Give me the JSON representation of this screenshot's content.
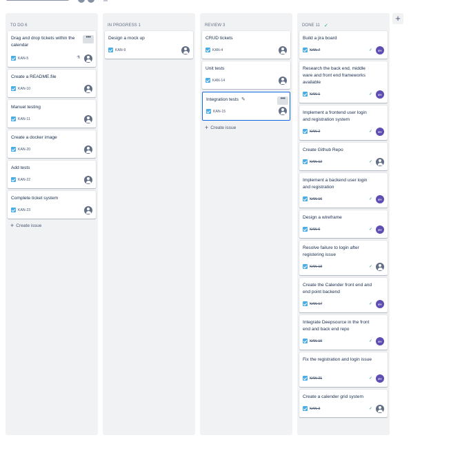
{
  "columns": [
    {
      "title": "TO DO 6",
      "create_label": "Create issue",
      "cards": [
        {
          "title": "Drag and drop tickets within the calendar",
          "key": "KAN-5"
        },
        {
          "title": "Create a README.file",
          "key": "KAN-10"
        },
        {
          "title": "Manuel testing",
          "key": "KAN-11"
        },
        {
          "title": "Create a docker image",
          "key": "KAN-20"
        },
        {
          "title": "Add tests",
          "key": "KAN-22"
        },
        {
          "title": "Complete ticket system",
          "key": "KAN-23"
        }
      ]
    },
    {
      "title": "IN PROGRESS 1",
      "cards": [
        {
          "title": "Design a mock up",
          "key": "KAN-9"
        }
      ]
    },
    {
      "title": "REVIEW 3",
      "create_label": "Create issue",
      "cards": [
        {
          "title": "CRUD tickets",
          "key": "KAN-4"
        },
        {
          "title": "Unit tests",
          "key": "KAN-14"
        },
        {
          "title": "Integration tests",
          "key": "KAN-15"
        }
      ]
    },
    {
      "title": "DONE 11",
      "cards": [
        {
          "title": "Build a jira board",
          "key": "KAN-7",
          "initials": "EY"
        },
        {
          "title": "Research the back end, middle ware and front end frameworks available",
          "key": "KAN-1",
          "initials": "EY"
        },
        {
          "title": "Implement a frontend user login and registration system",
          "key": "KAN-2",
          "initials": "EY"
        },
        {
          "title": "Create Github Repo",
          "key": "KAN-12"
        },
        {
          "title": "Implement a backend user login and registration",
          "key": "KAN-16",
          "initials": "EY"
        },
        {
          "title": "Design a wireframe",
          "key": "KAN-6",
          "initials": "EY"
        },
        {
          "title": "Resolve failure to login after registering issue",
          "key": "KAN-18"
        },
        {
          "title": "Create the Calender front end and end point backend",
          "key": "KAN-17",
          "initials": "EY"
        },
        {
          "title": "Integrate Deepsource in the front end and back end repo",
          "key": "KAN-19",
          "initials": "EY"
        },
        {
          "title": "Fix the registration and login issue",
          "key": "KAN-21",
          "initials": "EY"
        },
        {
          "title": "Create a calender grid system",
          "key": "KAN-3"
        }
      ]
    }
  ],
  "icons": {
    "more": "more-horizontal-icon",
    "add_column": "plus-icon",
    "issue_type": "task-checkbox-icon",
    "assignee": "user-avatar-icon",
    "done": "check-icon",
    "edit": "pencil-icon"
  },
  "colors": {
    "column_bg": "#f1f2f4",
    "task_icon": "#4bade8",
    "done_green": "#22a06b",
    "avatar_purple": "#5e4db2",
    "selection_blue": "#0c66e4"
  }
}
